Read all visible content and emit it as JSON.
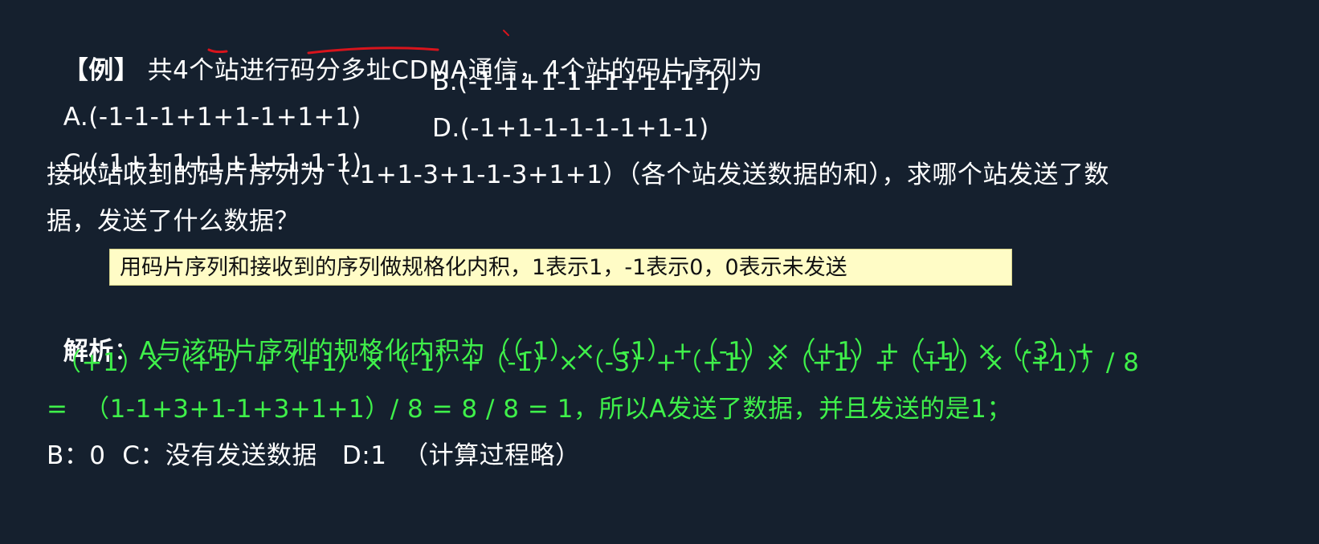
{
  "example": {
    "tag": "【例】",
    "text": " 共4个站进行码分多址CDMA通信，4个站的码片序列为"
  },
  "options": {
    "a": "A.(-1-1-1+1+1-1+1+1)",
    "b": "B.(-1-1+1-1+1+1+1-1)",
    "c": "C.(-1+1-1+1+1+1-1-1)",
    "d": "D.(-1+1-1-1-1-1+1-1)"
  },
  "question": {
    "line1": "接收站收到的码片序列为（-1+1-3+1-1-3+1+1）（各个站发送数据的和），求哪个站发送了数",
    "line2": "据，发送了什么数据？"
  },
  "hint": "用码片序列和接收到的序列做规格化内积，1表示1，-1表示0，0表示未发送",
  "analysis": {
    "label": "解析",
    "colon": "：",
    "line1": "A与该码片序列的规格化内积为（（-1）×（-1）+（-1）×（+1）+（-1）×（-3）+",
    "line2": "（+1）×（+1）+（+1）×（-1）+（-1）×（-3）+（+1）×（+1）+（+1）×（+1））/ 8",
    "line3": "=  （1-1+3+1-1+3+1+1）/ 8 = 8 / 8 = 1，所以A发送了数据，并且发送的是1；",
    "line4": "B：0  C：没有发送数据   D:1  （计算过程略）"
  },
  "colors": {
    "background": "#15202e",
    "text": "#ffffff",
    "analysis": "#3ff04a",
    "highlight": "#fffcc6",
    "annotation": "#d8141c"
  }
}
